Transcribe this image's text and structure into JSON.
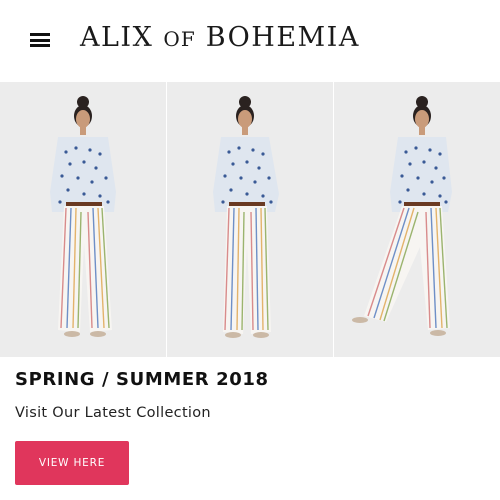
{
  "header": {
    "menu_icon": "hamburger-menu-icon",
    "logo_main_1": "ALIX",
    "logo_small": "OF",
    "logo_main_2": "BOHEMIA"
  },
  "hero": {
    "images": [
      {
        "name": "model-front-pose"
      },
      {
        "name": "model-front-pose-2"
      },
      {
        "name": "model-walking-pose"
      }
    ]
  },
  "promo": {
    "title": "SPRING / SUMMER 2018",
    "subtitle": "Visit Our Latest Collection",
    "cta_label": "VIEW HERE",
    "cta_color": "#e0365c"
  }
}
